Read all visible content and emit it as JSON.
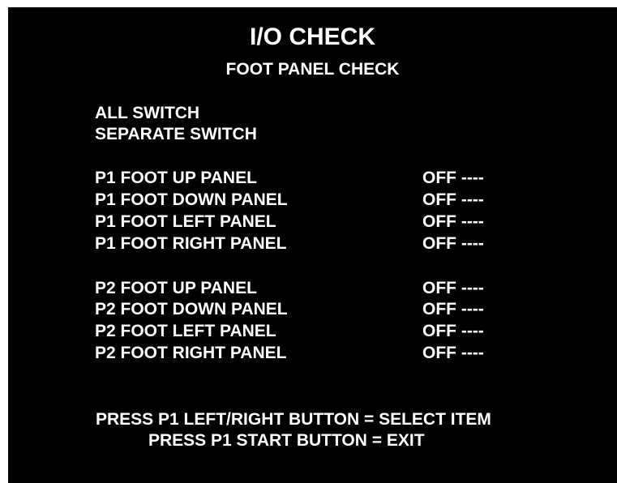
{
  "title": "I/O CHECK",
  "subtitle": "FOOT PANEL CHECK",
  "menu": [
    "ALL SWITCH",
    "SEPARATE SWITCH"
  ],
  "p1_panels": [
    {
      "label": "P1 FOOT UP PANEL",
      "value": "OFF ----"
    },
    {
      "label": "P1 FOOT DOWN PANEL",
      "value": "OFF ----"
    },
    {
      "label": "P1 FOOT LEFT PANEL",
      "value": "OFF ----"
    },
    {
      "label": "P1 FOOT RIGHT PANEL",
      "value": "OFF ----"
    }
  ],
  "p2_panels": [
    {
      "label": "P2 FOOT UP PANEL",
      "value": "OFF ----"
    },
    {
      "label": "P2 FOOT DOWN PANEL",
      "value": "OFF ----"
    },
    {
      "label": "P2 FOOT LEFT PANEL",
      "value": "OFF ----"
    },
    {
      "label": "P2 FOOT RIGHT PANEL",
      "value": "OFF ----"
    }
  ],
  "instructions": [
    "PRESS P1 LEFT/RIGHT BUTTON = SELECT ITEM",
    "PRESS P1 START BUTTON = EXIT"
  ],
  "colors": {
    "background": "#000000",
    "text": "#ffffff",
    "border": "#ffffff"
  }
}
